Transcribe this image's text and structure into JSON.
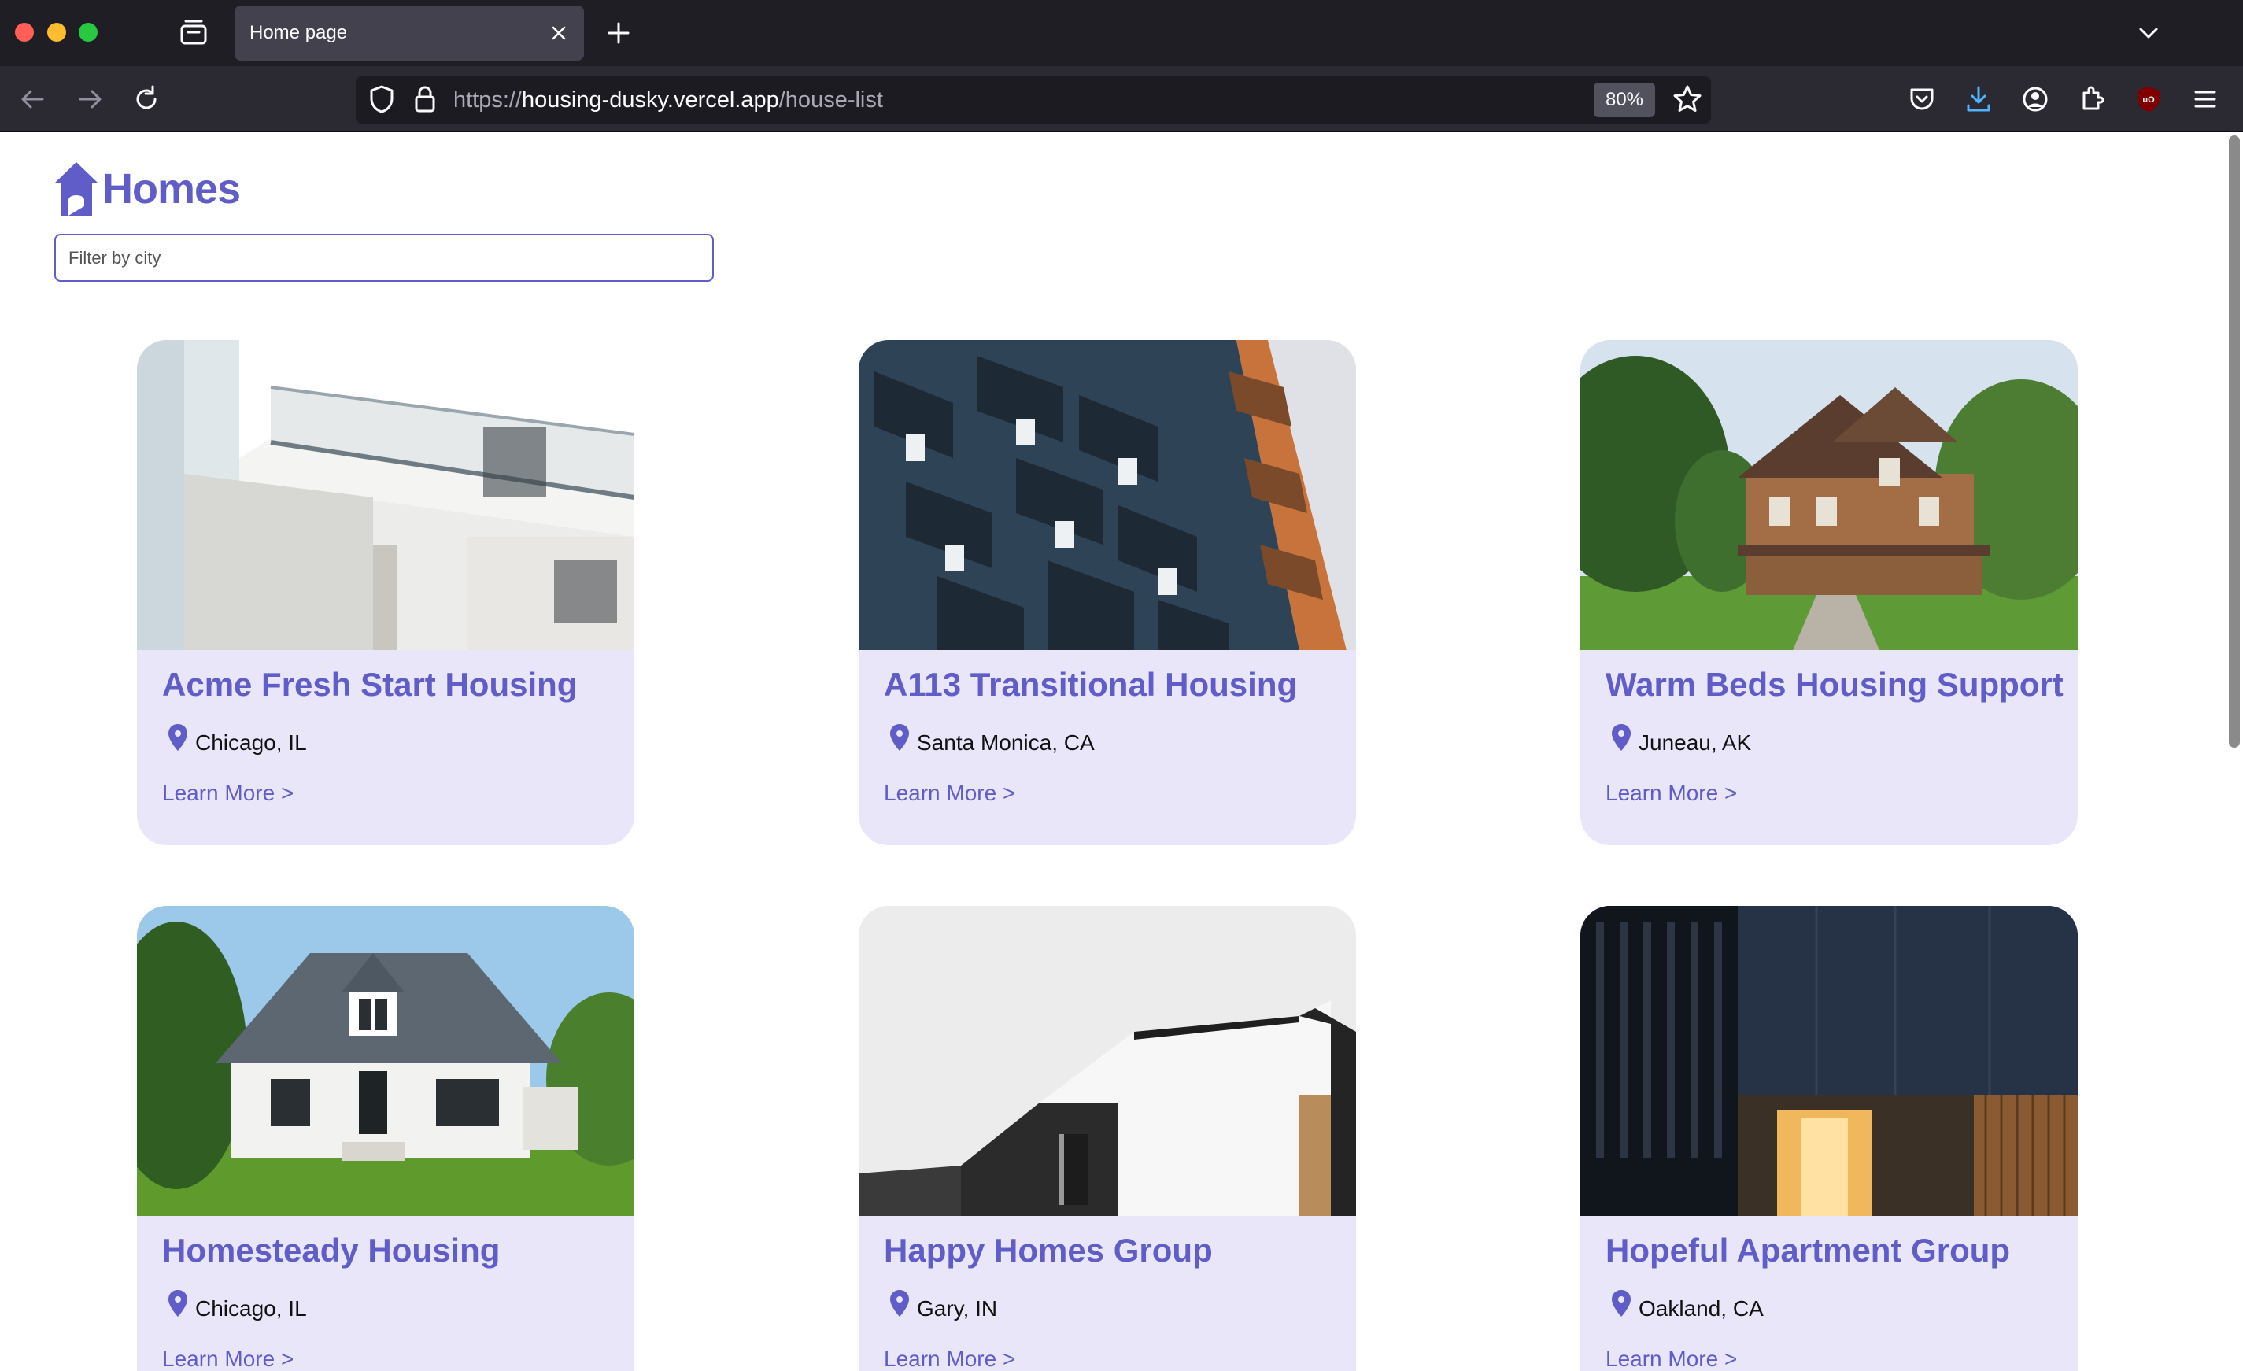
{
  "browser": {
    "tab_title": "Home page",
    "url_scheme": "https://",
    "url_host": "housing-dusky.vercel.app",
    "url_path": "/house-list",
    "zoom": "80%"
  },
  "header": {
    "logo_text": "Homes",
    "filter_placeholder": "Filter by city"
  },
  "listings": [
    {
      "name": "Acme Fresh Start Housing",
      "location": "Chicago, IL",
      "link": "Learn More >"
    },
    {
      "name": "A113 Transitional Housing",
      "location": "Santa Monica, CA",
      "link": "Learn More >"
    },
    {
      "name": "Warm Beds Housing Support",
      "location": "Juneau, AK",
      "link": "Learn More >"
    },
    {
      "name": "Homesteady Housing",
      "location": "Chicago, IL",
      "link": "Learn More >"
    },
    {
      "name": "Happy Homes Group",
      "location": "Gary, IN",
      "link": "Learn More >"
    },
    {
      "name": "Hopeful Apartment Group",
      "location": "Oakland, CA",
      "link": "Learn More >"
    }
  ],
  "colors": {
    "accent": "#605dc8",
    "card_bg": "#e9e6fa"
  }
}
